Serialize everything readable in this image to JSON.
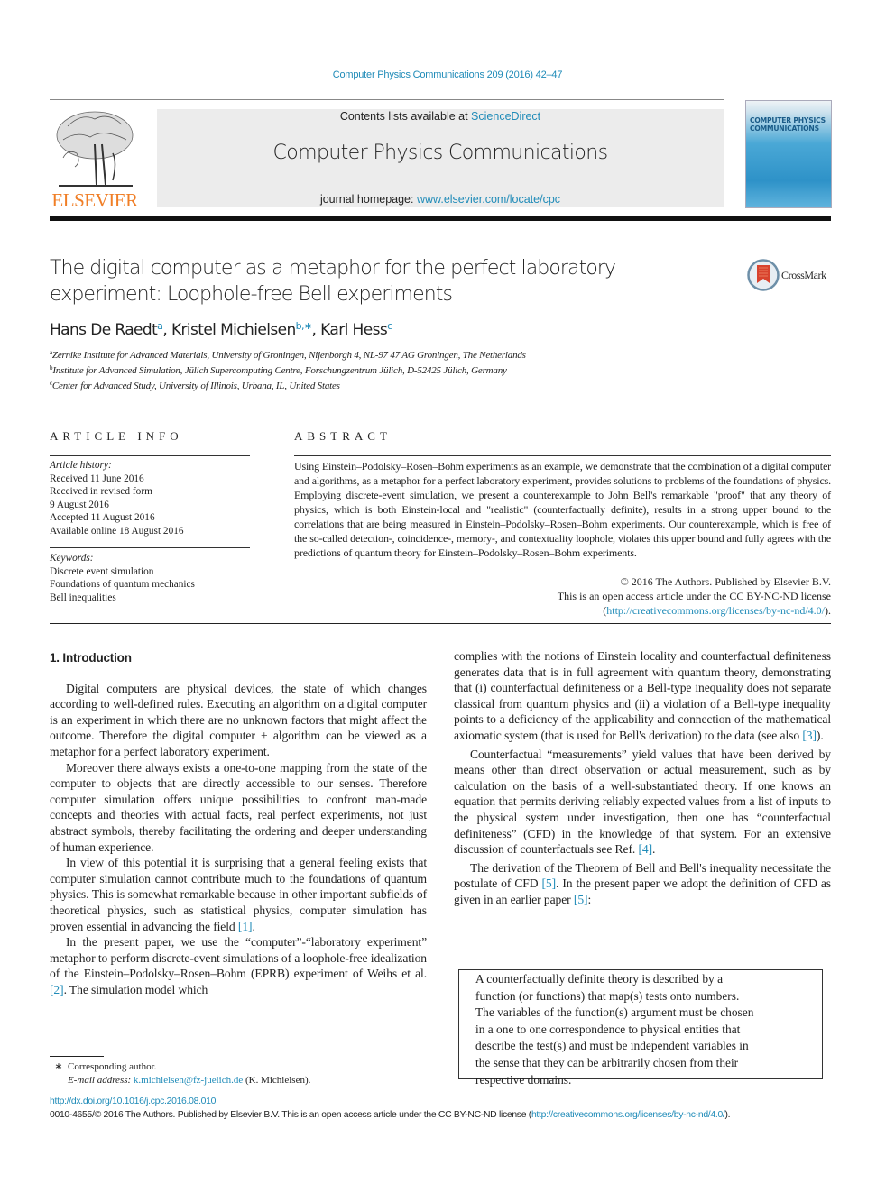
{
  "header": {
    "journal_ref": "Computer Physics Communications 209 (2016) 42–47",
    "contents_prefix": "Contents lists available at ",
    "contents_link": "ScienceDirect",
    "journal_name": "Computer Physics Communications",
    "homepage_prefix": "journal homepage: ",
    "homepage_link": "www.elsevier.com/locate/cpc",
    "publisher_logo": "ELSEVIER",
    "cover_title_line1": "COMPUTER PHYSICS",
    "cover_title_line2": "COMMUNICATIONS",
    "crossmark_label": "CrossMark"
  },
  "article": {
    "title_line1": "The digital computer as a metaphor for the perfect laboratory",
    "title_line2": "experiment: Loophole-free Bell experiments",
    "authors": [
      {
        "name": "Hans De Raedt",
        "sup": "a"
      },
      {
        "name": "Kristel Michielsen",
        "sup": "b,∗"
      },
      {
        "name": "Karl Hess",
        "sup": "c"
      }
    ],
    "affiliations": [
      {
        "sup": "a",
        "text": "Zernike Institute for Advanced Materials, University of Groningen, Nijenborgh 4, NL-97 47 AG Groningen, The Netherlands"
      },
      {
        "sup": "b",
        "text": "Institute for Advanced Simulation, Jülich Supercomputing Centre, Forschungzentrum Jülich, D-52425 Jülich, Germany"
      },
      {
        "sup": "c",
        "text": "Center for Advanced Study, University of Illinois, Urbana, IL, United States"
      }
    ]
  },
  "article_info": {
    "heading": "ARTICLE INFO",
    "history_label": "Article history:",
    "history": [
      "Received 11 June 2016",
      "Received in revised form",
      "9 August 2016",
      "Accepted 11 August 2016",
      "Available online 18 August 2016"
    ],
    "keywords_label": "Keywords:",
    "keywords": [
      "Discrete event simulation",
      "Foundations of quantum mechanics",
      "Bell inequalities"
    ]
  },
  "abstract": {
    "heading": "ABSTRACT",
    "text": "Using Einstein–Podolsky–Rosen–Bohm experiments as an example, we demonstrate that the combination of a digital computer and algorithms, as a metaphor for a perfect laboratory experiment, provides solutions to problems of the foundations of physics. Employing discrete-event simulation, we present a counterexample to John Bell's remarkable \"proof\" that any theory of physics, which is both Einstein-local and \"realistic\" (counterfactually definite), results in a strong upper bound to the correlations that are being measured in Einstein–Podolsky–Rosen–Bohm experiments. Our counterexample, which is free of the so-called detection-, coincidence-, memory-, and contextuality loophole, violates this upper bound and fully agrees with the predictions of quantum theory for Einstein–Podolsky–Rosen–Bohm experiments.",
    "copyright": "© 2016 The Authors. Published by Elsevier B.V.",
    "license_text": "This is an open access article under the CC BY-NC-ND license",
    "license_link": "http://creativecommons.org/licenses/by-nc-nd/4.0/"
  },
  "body": {
    "section_heading": "1.  Introduction",
    "left_paragraphs": [
      "Digital computers are physical devices, the state of which changes according to well-defined rules. Executing an algorithm on a digital computer is an experiment in which there are no unknown factors that might affect the outcome. Therefore the digital computer + algorithm can be viewed as a metaphor for a perfect laboratory experiment.",
      "Moreover there always exists a one-to-one mapping from the state of the computer to objects that are directly accessible to our senses. Therefore computer simulation offers unique possibilities to confront man-made concepts and theories with actual facts, real perfect experiments, not just abstract symbols, thereby facilitating the ordering and deeper understanding of human experience.",
      "In view of this potential it is surprising that a general feeling exists that computer simulation cannot contribute much to the foundations of quantum physics. This is somewhat remarkable because in other important subfields of theoretical physics, such as statistical physics, computer simulation has proven essential in advancing the field "
    ],
    "ref1": "[1]",
    "left_p4_a": "In the present paper, we use the “computer”-“laboratory experiment” metaphor to perform discrete-event simulations of a loophole-free idealization of the Einstein–Podolsky–Rosen–Bohm (EPRB) experiment of Weihs et al. ",
    "ref2": "[2]",
    "left_p4_b": ". The simulation model which",
    "right_p1": "complies with the notions of Einstein locality and counterfactual definiteness generates data that is in full agreement with quantum theory, demonstrating that (i) counterfactual definiteness or a Bell-type inequality does not separate classical from quantum physics and (ii) a violation of a Bell-type inequality points to a deficiency of the applicability and connection of the mathematical axiomatic system (that is used for Bell's derivation) to the data (see also ",
    "ref3": "[3]",
    "right_p1_end": ").",
    "right_p2": "Counterfactual “measurements” yield values that have been derived by means other than direct observation or actual measurement, such as by calculation on the basis of a well-substantiated theory. If one knows an equation that permits deriving reliably expected values from a list of inputs to the physical system under investigation, then one has “counterfactual definiteness” (CFD) in the knowledge of that system. For an extensive discussion of counterfactuals see Ref. ",
    "ref4": "[4]",
    "right_p3_a": "The derivation of the Theorem of Bell and Bell's inequality necessitate the postulate of CFD ",
    "ref5a": "[5]",
    "right_p3_b": ". In the present paper we adopt the definition of CFD as given in an earlier paper ",
    "ref5b": "[5]",
    "cfd_box_lines": [
      "A counterfactually definite theory is described by a",
      "function (or functions) that map(s) tests onto numbers.",
      "The variables of the function(s) argument must be chosen",
      "in a one to one correspondence to physical entities that",
      "describe the test(s) and must be independent variables in",
      "the sense that they can be arbitrarily chosen from their",
      "respective domains."
    ]
  },
  "footnote": {
    "star": "∗",
    "corresponding": "Corresponding author.",
    "email_label": "E-mail address: ",
    "email": "k.michielsen@fz-juelich.de",
    "email_suffix": " (K. Michielsen)."
  },
  "footer": {
    "doi": "http://dx.doi.org/10.1016/j.cpc.2016.08.010",
    "issn_text": "0010-4655/© 2016 The Authors. Published by Elsevier B.V. This is an open access article under the CC BY-NC-ND license (",
    "license_link": "http://creativecommons.org/licenses/by-nc-nd/4.0/",
    "license_suffix": ")."
  }
}
